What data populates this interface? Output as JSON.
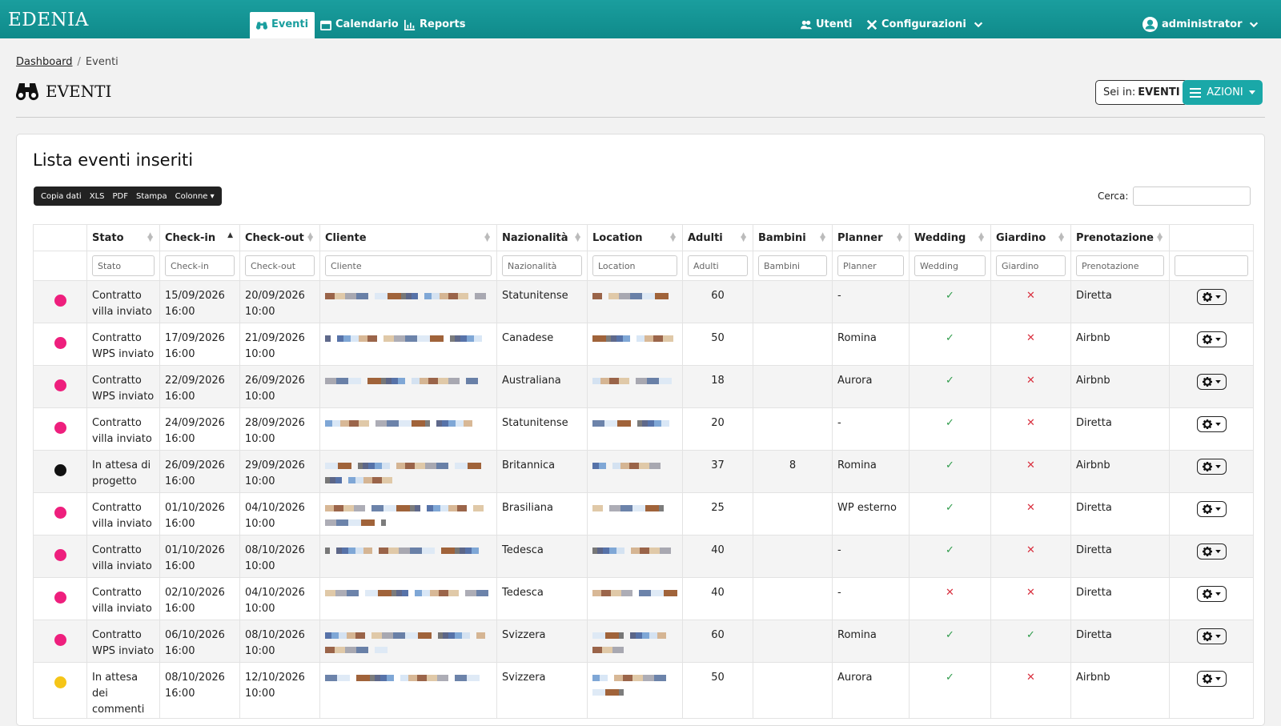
{
  "brand": "EDENIA",
  "nav": {
    "eventi": "Eventi",
    "calendario": "Calendario",
    "reports": "Reports",
    "utenti": "Utenti",
    "configurazioni": "Configurazioni",
    "user": "administrator"
  },
  "breadcrumb": {
    "home": "Dashboard",
    "current": "Eventi"
  },
  "page_title": "EVENTI",
  "location_label": "Sei in:",
  "location_value": "EVENTI",
  "azioni_label": "AZIONI",
  "card_title": "Lista eventi inseriti",
  "toolbar": [
    "Copia dati",
    "XLS",
    "PDF",
    "Stampa",
    "Colonne"
  ],
  "search_label": "Cerca:",
  "columns": [
    "",
    "Stato",
    "Check-in",
    "Check-out",
    "Cliente",
    "Nazionalità",
    "Location",
    "Adulti",
    "Bambini",
    "Planner",
    "Wedding",
    "Giardino",
    "Prenotazione",
    ""
  ],
  "filters": [
    "",
    "Stato",
    "Check-in",
    "Check-out",
    "Cliente",
    "Nazionalità",
    "Location",
    "Adulti",
    "Bambini",
    "Planner",
    "Wedding",
    "Giardino",
    "Prenotazione",
    ""
  ],
  "colors": {
    "magenta": "#ee1f7d",
    "black": "#111111",
    "yellow": "#f5c518",
    "teal": "#1a9e9e"
  },
  "rows": [
    {
      "dot": "#ee1f7d",
      "stato1": "Contratto",
      "stato2": "villa inviato",
      "cin1": "15/09/2026",
      "cin2": "16:00",
      "cout1": "20/09/2026",
      "cout2": "10:00",
      "naz": "Statunitense",
      "adulti": "60",
      "bambini": "",
      "planner": "-",
      "wedding": "✓",
      "giardino": "✕",
      "pren": "Diretta"
    },
    {
      "dot": "#ee1f7d",
      "stato1": "Contratto",
      "stato2": "WPS inviato",
      "cin1": "17/09/2026",
      "cin2": "16:00",
      "cout1": "21/09/2026",
      "cout2": "10:00",
      "naz": "Canadese",
      "adulti": "50",
      "bambini": "",
      "planner": "Romina",
      "wedding": "✓",
      "giardino": "✕",
      "pren": "Airbnb"
    },
    {
      "dot": "#ee1f7d",
      "stato1": "Contratto",
      "stato2": "WPS inviato",
      "cin1": "22/09/2026",
      "cin2": "16:00",
      "cout1": "26/09/2026",
      "cout2": "10:00",
      "naz": "Australiana",
      "adulti": "18",
      "bambini": "",
      "planner": "Aurora",
      "wedding": "✓",
      "giardino": "✕",
      "pren": "Airbnb"
    },
    {
      "dot": "#ee1f7d",
      "stato1": "Contratto",
      "stato2": "villa inviato",
      "cin1": "24/09/2026",
      "cin2": "16:00",
      "cout1": "28/09/2026",
      "cout2": "10:00",
      "naz": "Statunitense",
      "adulti": "20",
      "bambini": "",
      "planner": "-",
      "wedding": "✓",
      "giardino": "✕",
      "pren": "Diretta"
    },
    {
      "dot": "#111111",
      "stato1": "In attesa di",
      "stato2": "progetto",
      "cin1": "26/09/2026",
      "cin2": "16:00",
      "cout1": "29/09/2026",
      "cout2": "10:00",
      "naz": "Britannica",
      "adulti": "37",
      "bambini": "8",
      "planner": "Romina",
      "wedding": "✓",
      "giardino": "✕",
      "pren": "Airbnb"
    },
    {
      "dot": "#ee1f7d",
      "stato1": "Contratto",
      "stato2": "villa inviato",
      "cin1": "01/10/2026",
      "cin2": "16:00",
      "cout1": "04/10/2026",
      "cout2": "10:00",
      "naz": "Brasiliana",
      "adulti": "25",
      "bambini": "",
      "planner": "WP esterno",
      "wedding": "✓",
      "giardino": "✕",
      "pren": "Diretta"
    },
    {
      "dot": "#ee1f7d",
      "stato1": "Contratto",
      "stato2": "villa inviato",
      "cin1": "01/10/2026",
      "cin2": "16:00",
      "cout1": "08/10/2026",
      "cout2": "10:00",
      "naz": "Tedesca",
      "adulti": "40",
      "bambini": "",
      "planner": "-",
      "wedding": "✓",
      "giardino": "✕",
      "pren": "Diretta"
    },
    {
      "dot": "#ee1f7d",
      "stato1": "Contratto",
      "stato2": "villa inviato",
      "cin1": "02/10/2026",
      "cin2": "16:00",
      "cout1": "04/10/2026",
      "cout2": "10:00",
      "naz": "Tedesca",
      "adulti": "40",
      "bambini": "",
      "planner": "-",
      "wedding": "✕",
      "giardino": "✕",
      "pren": "Diretta"
    },
    {
      "dot": "#ee1f7d",
      "stato1": "Contratto",
      "stato2": "WPS inviato",
      "cin1": "06/10/2026",
      "cin2": "16:00",
      "cout1": "08/10/2026",
      "cout2": "10:00",
      "naz": "Svizzera",
      "adulti": "60",
      "bambini": "",
      "planner": "Romina",
      "wedding": "✓",
      "giardino": "✓",
      "pren": "Diretta"
    },
    {
      "dot": "#f5c518",
      "stato1": "In attesa dei",
      "stato2": "commenti",
      "cin1": "08/10/2026",
      "cin2": "16:00",
      "cout1": "12/10/2026",
      "cout2": "10:00",
      "naz": "Svizzera",
      "adulti": "50",
      "bambini": "",
      "planner": "Aurora",
      "wedding": "✓",
      "giardino": "✕",
      "pren": "Airbnb"
    }
  ]
}
